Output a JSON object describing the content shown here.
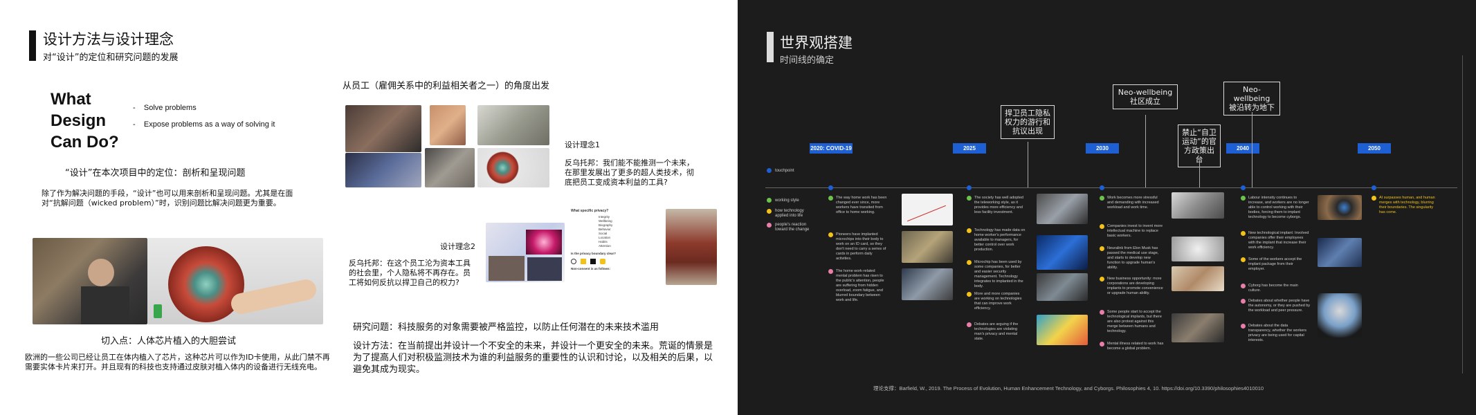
{
  "left": {
    "title": "设计方法与设计理念",
    "subtitle": "对“设计”的定位和研究问题的发展",
    "what_design": [
      "What",
      "Design",
      "Can Do?"
    ],
    "bullets": [
      "Solve problems",
      "Expose problems as a way of solving it"
    ],
    "positioning_title": "“设计”在本次项目中的定位：剖析和呈现问题",
    "positioning_text": "除了作为解决问题的手段，“设计”也可以用来剖析和呈现问题。尤其是在面对“抗解问题（wicked problem）”时，识别问题比解决问题更为重要。",
    "entry_title": "切入点：人体芯片植入的大胆尝试",
    "entry_text": "欧洲的一些公司已经让员工在体内植入了芯片，这种芯片可以作为ID卡使用，从此门禁不再需要实体卡片来打开。并且现有的科技也支持通过皮肤对植入体内的设备进行无线充电。",
    "employee_title": "从员工（雇佣关系中的利益相关者之一）的角度出发",
    "concept1_title": "设计理念1",
    "concept1_text": "反乌托邦：我们能不能推测一个未来，在那里发展出了更多的超人类技术，彻底把员工变成资本利益的工具?",
    "concept2_title": "设计理念2",
    "concept2_text": "反乌托邦：在这个员工沦为资本工具的社会里，个人隐私将不再存在。员工将如何反抗以捍卫自己的权力?",
    "research_q": "研究问题：科技服务的对象需要被严格监控，以防止任何潜在的未来技术滥用",
    "method": "设计方法：在当前提出并设计一个不安全的未来，并设计一个更安全的未来。荒诞的情景是为了提高人们对积极监测技术为谁的利益服务的重要性的认识和讨论，以及相关的后果，以避免其成为现实。",
    "doc_title": "What specific privacy?",
    "doc_list": [
      "Integrity",
      "Wellbeing",
      "Biography",
      "Behavior",
      "Social",
      "Location",
      "Habits",
      "Attention"
    ],
    "doc_text": "Is the privacy boundary clear?",
    "doc_footer": "Non-consent is as follows:"
  },
  "right": {
    "title": "世界观搭建",
    "subtitle": "时间线的确定",
    "years": [
      "2020: COVID-19",
      "2025",
      "2030",
      "2040",
      "2050"
    ],
    "boxes": [
      {
        "lines": [
          "捍卫员工隐私",
          "权力的游行和",
          "抗议出现"
        ]
      },
      {
        "lines": [
          "Neo-wellbeing",
          "社区成立"
        ]
      },
      {
        "lines": [
          "禁止“自卫",
          "运动”的官",
          "方政策出台"
        ]
      },
      {
        "lines": [
          "Neo-wellbeing",
          "被沿转为地下"
        ]
      }
    ],
    "touchpoint": "touchpoint",
    "legend": [
      "working style",
      "how technology applied into life",
      "people's reaction toward the change"
    ],
    "events": {
      "c1": [
        "The way home work has been changed ever since, more workers have transited from office to home working.",
        "Pioneers have implanted microchips into their body to work on an ID card, so they don't need to carry a series of cards in perform daily activities.",
        "The home work-related mental problem has risen to the public's attention, people are suffering from hidden overload, zoom fatigue, and blurred boundary between work and life."
      ],
      "c2": [
        "The society has well adopted the teleworking style, as it provides more efficiency and less facility investment.",
        "Technology has made data on home worker's performance available to managers, for better control over work production.",
        "Microchip has been used by some companies, for better and easier security management. Technology integrates to implanted in the body.",
        "More and more companies are working on technologies that can improve work efficiency.",
        "Debates are arguing if the technologies are violating man's privacy and mental state."
      ],
      "c3": [
        "Work becomes more stressful and demanding with increased workload and work time.",
        "Companies invest to invent more intellectual machine to replace basic workers.",
        "Neuralink from Elon Musk has passed the medical use stage, and starts to develop new function to upgrade human's ability.",
        "New business opportunity: more corporations are developing implants to promote convenience or upgrade human ability.",
        "Some people start to accept the technological implants, but there are also protest against this merge between humans and technology.",
        "Mental illness related to work has become a global problem."
      ],
      "c4": [
        "Labour intensity continues to increase, and workers are no longer able to control working with their bodies, forcing them to implant technology to become cyborgs.",
        "New technological implant: Involved companies offer their employees with the implant that increase their work efficiency.",
        "Some of the workers accept the implant package from their employer.",
        "Cyborg has become the main culture.",
        "Debates about whether people have the autonomy, or they are pushed by the workload and peer pressure.",
        "Debates about the data transparency, whether the workers privacy are being used for capital interests."
      ],
      "c5": [
        "AI surpasses human, and human merges with technology, blurring their boundaries. The singularity has come."
      ]
    },
    "citation": "理论支撑：Barfield, W., 2019. The Process of Evolution, Human Enhancement Technology, and Cyborgs. Philosophies 4, 10. https://doi.org/10.3390/philosophies4010010",
    "colors": {
      "blue": "#1f5fd4",
      "green": "#6cc24a",
      "yellow": "#f2c21b",
      "pink": "#e87fa8",
      "accent_text": "#f2c21b"
    }
  }
}
